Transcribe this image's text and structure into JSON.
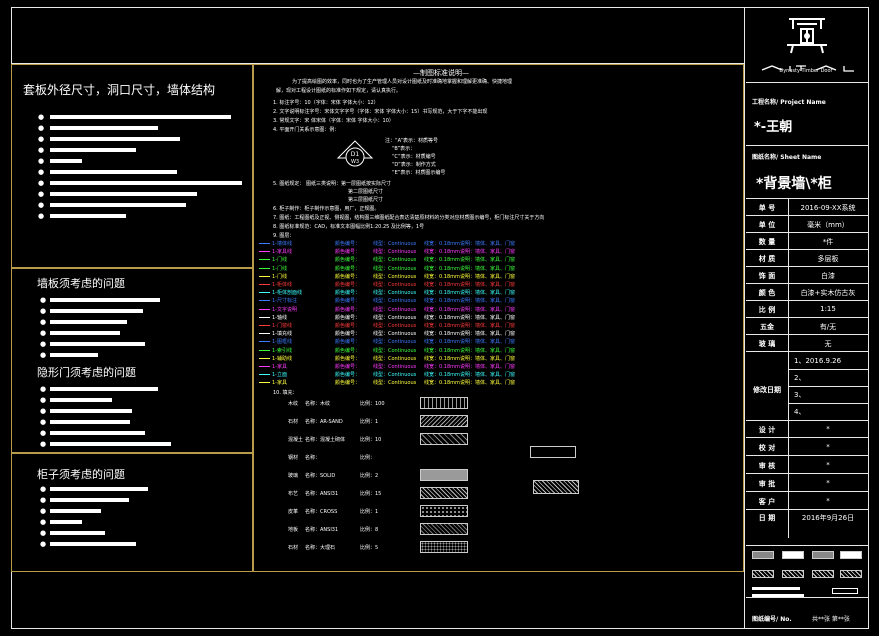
{
  "left": {
    "outer_title": "套板外径尺寸，洞口尺寸，墙体结构",
    "wall_title": "墙板须考虑的问题",
    "door_title": "隐形门须考虑的问题",
    "cabinet_title": "柜子须考虑的问题"
  },
  "notes": {
    "heading": "—制图标准说明—",
    "intro_1": "为了提高绘图的效率，同时也为了生产管理人员对设计图纸及时准确地掌握和理解更准确、快捷地理",
    "intro_2": "解，现对工程设计图纸的标准作如下规定，请认真执行。",
    "item_1": "1. 标注字号：10（字体：宋体  字体大小：12）",
    "item_2": "2. 文字说明标注字号：宋体文字字号（字体：宋体  字体大小：15）书写规范，大于下字不能出现",
    "item_3": "3. 常规文字：宋  体宋体（字体：宋体  字体大小：10）",
    "item_4": "4. 平面开门关系示意图：例：",
    "legend_1": "注：“A”表示：材质等号",
    "legend_2": "“B”表示：",
    "legend_3": "“C”表示：材质编号",
    "legend_4": "“D”表示：制作方式",
    "legend_5": "“E”表示：材质图示编号",
    "item_5a": "5. 图纸规定：  图纸三类说明：第一层图纸按实际尺寸",
    "item_5b": "第二层图纸尺寸",
    "item_5c": "第三层图纸尺寸",
    "item_6": "6. 柜子制作：柜子制作示意图，用厂，正规图。",
    "item_7": "7. 图纸：工程图纸及正视、侧视图，结构图三维图纸配合表达清楚原材料的分类对应材质图示编号，柜门标注尺寸关于方向",
    "item_8": "8. 图纸标准规范：CAD，标准文本图幅比例1:20.25 及比例等，1号",
    "item_9": "9. 图层：",
    "item_10": "10. 填充："
  },
  "layers": [
    {
      "name": "1-墙体线",
      "color": "#3c7cff"
    },
    {
      "name": "1-家具线",
      "color": "#ff3cff"
    },
    {
      "name": "1-门线",
      "color": "#3cff3c"
    },
    {
      "name": "1-门线",
      "color": "#3cff3c"
    },
    {
      "name": "1-门线",
      "color": "#ffff3c"
    },
    {
      "name": "1-柜体线",
      "color": "#ff3c3c"
    },
    {
      "name": "1-柜体剖面线",
      "color": "#3cffff"
    },
    {
      "name": "1-尺寸标注",
      "color": "#3c7cff"
    },
    {
      "name": "1-文字说明",
      "color": "#ff3cff"
    },
    {
      "name": "1-轴线",
      "color": "#ffffff"
    },
    {
      "name": "1-门窗线",
      "color": "#ff3c3c"
    },
    {
      "name": "1-填充线",
      "color": "#ffffff"
    },
    {
      "name": "1-图框线",
      "color": "#3c7cff"
    },
    {
      "name": "1-索引线",
      "color": "#3cff3c"
    },
    {
      "name": "1-辅助线",
      "color": "#ffff3c"
    },
    {
      "name": "1-家具",
      "color": "#ff3cff"
    },
    {
      "name": "1-立面",
      "color": "#3cffff"
    },
    {
      "name": "1-家具",
      "color": "#ffff3c"
    }
  ],
  "layer_cols": {
    "col2": "颜色编号：",
    "col3": "线型：Continuous",
    "col4": "线宽：0.18mm",
    "col5": "说明：墙体、家具、门窗"
  },
  "fills": [
    {
      "lbl": "木纹",
      "name": "名称：木纹",
      "ratio": "比例：100"
    },
    {
      "lbl": "石材",
      "name": "名称：AR-SAND",
      "ratio": "比例：1"
    },
    {
      "lbl": "混凝土",
      "name": "名称：混凝土砌体",
      "ratio": "比例：10"
    },
    {
      "lbl": "钢材",
      "name": "名称：",
      "ratio": "比例："
    },
    {
      "lbl": "玻璃",
      "name": "名称：SOLID",
      "ratio": "比例：2"
    },
    {
      "lbl": "布艺",
      "name": "名称：ANSI31",
      "ratio": "比例：15"
    },
    {
      "lbl": "皮革",
      "name": "名称：CROSS",
      "ratio": "比例：1"
    },
    {
      "lbl": "地板",
      "name": "名称：ANSI31",
      "ratio": "比例：8"
    },
    {
      "lbl": "石材",
      "name": "名称：大理石",
      "ratio": "比例：5"
    }
  ],
  "titleblock": {
    "brand": "Dynasty Timber Door",
    "project_label": "工程名称/ Project Name",
    "project_name": "*-王朝",
    "sheet_label": "图纸名称/ Sheet Name",
    "sheet_name": "*背景墙\\*柜",
    "rows": [
      {
        "k": "单  号",
        "v": "2016-09-XX系统"
      },
      {
        "k": "单  位",
        "v": "毫米（mm）"
      },
      {
        "k": "数  量",
        "v": "*件"
      },
      {
        "k": "材  质",
        "v": "多层板"
      },
      {
        "k": "饰  面",
        "v": "白漆"
      },
      {
        "k": "颜  色",
        "v": "白漆+实木仿古灰"
      },
      {
        "k": "比  例",
        "v": "1:15"
      },
      {
        "k": "五金",
        "v": "有/无"
      },
      {
        "k": "玻  璃",
        "v": "无"
      }
    ],
    "revision_label": "修改日期",
    "revisions": [
      "1、2016.9.26",
      "2、",
      "3、",
      "4、"
    ],
    "signs": [
      {
        "k": "设  计",
        "v": "*"
      },
      {
        "k": "校  对",
        "v": "*"
      },
      {
        "k": "审  核",
        "v": "*"
      },
      {
        "k": "审  批",
        "v": "*"
      },
      {
        "k": "客  户",
        "v": "*"
      }
    ],
    "date_label": "日  期",
    "date_value": "2016年9月26日",
    "sheet_no": "图纸编号/ No.",
    "count": "共**张 第**张"
  }
}
